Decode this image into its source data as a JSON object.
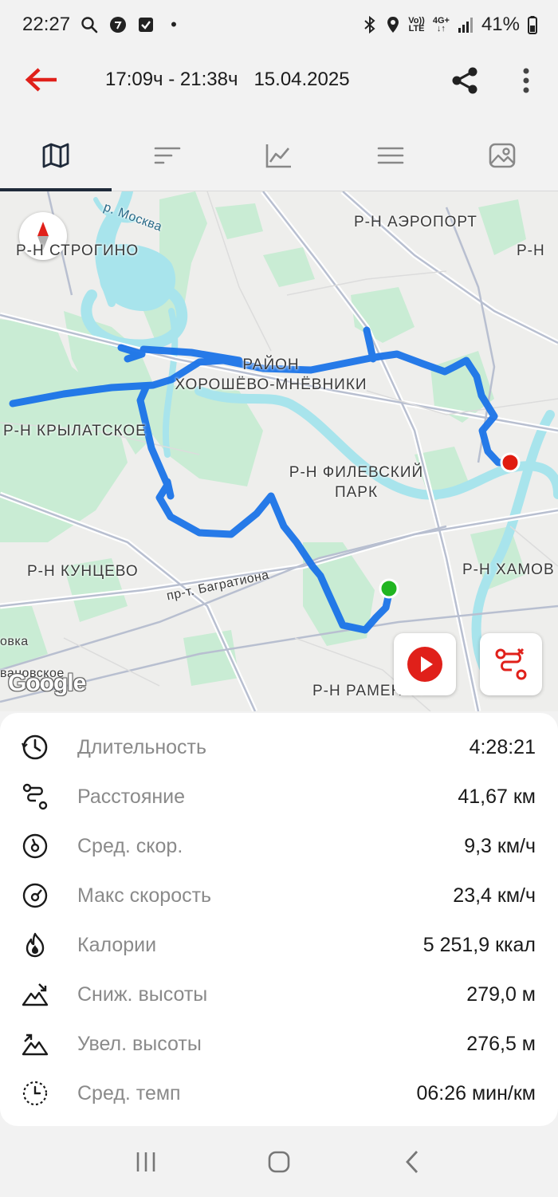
{
  "status_bar": {
    "time": "22:27",
    "dot": "•",
    "volte_top": "Vo))",
    "volte_bottom": "LTE",
    "network_top": "4G+",
    "network_bottom": "↓↑",
    "battery": "41%",
    "icons": [
      "search-icon",
      "app-icon",
      "checkbox-icon",
      "bluetooth-icon",
      "location-icon",
      "signal-icon",
      "battery-icon"
    ]
  },
  "header": {
    "time_range": "17:09ч - 21:38ч",
    "date": "15.04.2025",
    "back_color": "#e0201a"
  },
  "tabs": [
    {
      "name": "map",
      "icon": "map-icon",
      "active": true
    },
    {
      "name": "splits",
      "icon": "bars-icon",
      "active": false
    },
    {
      "name": "chart",
      "icon": "chart-icon",
      "active": false
    },
    {
      "name": "list",
      "icon": "menu-icon",
      "active": false
    },
    {
      "name": "photos",
      "icon": "photo-icon",
      "active": false
    }
  ],
  "map": {
    "labels": {
      "moskva": "р. Москва",
      "aeroport": "Р-Н АЭРОПОРТ",
      "strogino": "Р-Н СТРОГИНО",
      "r_n_right": "Р-Н",
      "rayon": "РАЙОН",
      "khoroshevo": "ХОРОШЁВО-МНЁВНИКИ",
      "krylatskoe": "Р-Н КРЫЛАТСКОЕ",
      "filevsky_1": "Р-Н ФИЛЕВСКИЙ",
      "filevsky_2": "ПАРК",
      "kuntsevo": "Р-Н КУНЦЕВО",
      "khamov": "Р-Н ХАМОВ",
      "bagrationa": "пр-т. Багратиона",
      "ovka": "овка",
      "vanovskoe": "вановское",
      "ramenki": "Р-Н РАМЕНКИ"
    },
    "google": "Google",
    "route_color": "#1a73e8",
    "start_color": "#21b521",
    "finish_color": "#e01c10"
  },
  "stats": [
    {
      "label": "Длительность",
      "value": "4:28:21",
      "icon": "clock-icon"
    },
    {
      "label": "Расстояние",
      "value": "41,67 км",
      "icon": "route-icon"
    },
    {
      "label": "Сред. скор.",
      "value": "9,3 км/ч",
      "icon": "speedometer-icon"
    },
    {
      "label": "Макс скорость",
      "value": "23,4 км/ч",
      "icon": "max-speed-icon"
    },
    {
      "label": "Калории",
      "value": "5 251,9 ккал",
      "icon": "flame-icon"
    },
    {
      "label": "Сниж. высоты",
      "value": "279,0 м",
      "icon": "descent-icon"
    },
    {
      "label": "Увел. высоты",
      "value": "276,5 м",
      "icon": "ascent-icon"
    },
    {
      "label": "Сред. темп",
      "value": "06:26 мин/км",
      "icon": "pace-icon"
    }
  ]
}
